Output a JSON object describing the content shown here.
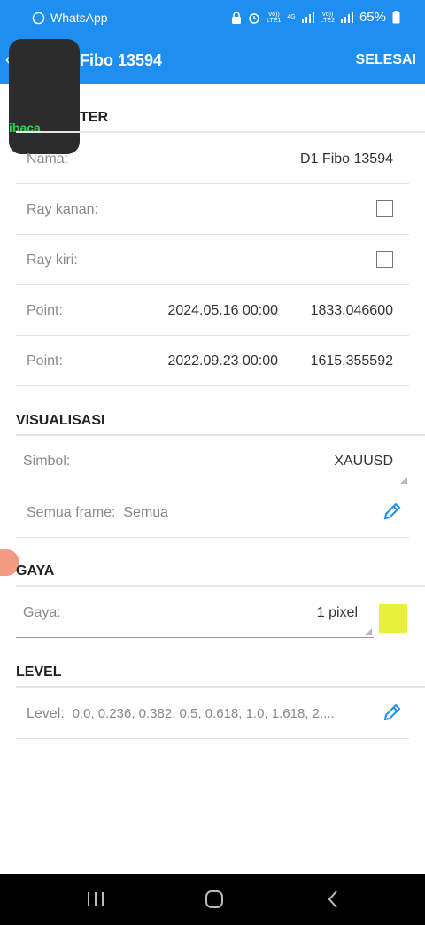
{
  "status_bar": {
    "app_name": "WhatsApp",
    "net1_top": "Vo))",
    "net1_bottom": "LTE1",
    "net_gen": "4G",
    "net2_top": "Vo))",
    "net2_bottom": "LTE2",
    "battery": "65%"
  },
  "app_bar": {
    "title": "Fibo 13594",
    "done_label": "SELESAI",
    "back_icon": "back-arrow-icon"
  },
  "overlay": {
    "text": "ibaca"
  },
  "parameter": {
    "header": "TER",
    "name_label": "Nama:",
    "name_value": "D1 Fibo 13594",
    "ray_right_label": "Ray kanan:",
    "ray_left_label": "Ray kiri:",
    "point1_label": "Point:",
    "point1_date": "2024.05.16 00:00",
    "point1_price": "1833.046600",
    "point2_label": "Point:",
    "point2_date": "2022.09.23 00:00",
    "point2_price": "1615.355592"
  },
  "visualisasi": {
    "header": "VISUALISASI",
    "symbol_label": "Simbol:",
    "symbol_value": "XAUUSD",
    "frames_label": "Semua frame:",
    "frames_value": "Semua"
  },
  "gaya": {
    "header": "GAYA",
    "style_label": "Gaya:",
    "style_value": "1 pixel",
    "color": "#e8f03c"
  },
  "level": {
    "header": "LEVEL",
    "level_label": "Level:",
    "level_value": "0.0, 0.236, 0.382, 0.5, 0.618, 1.0, 1.618, 2...."
  },
  "nav": {
    "recents": "recents-icon",
    "home": "home-icon",
    "back": "back-icon"
  }
}
